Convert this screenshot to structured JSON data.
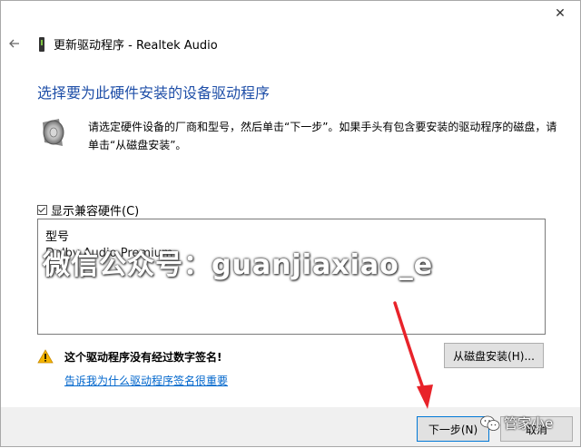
{
  "window": {
    "title": "更新驱动程序 - Realtek Audio",
    "close_symbol": "✕"
  },
  "main": {
    "heading": "选择要为此硬件安装的设备驱动程序",
    "description": "请选定硬件设备的厂商和型号，然后单击“下一步”。如果手头有包含要安装的驱动程序的磁盘，请单击“从磁盘安装”。",
    "compat_checkbox_label": "显示兼容硬件(C)",
    "compat_checked": true,
    "list": {
      "header": "型号",
      "items": [
        "Dolby Audio Premium"
      ]
    },
    "warning_text": "这个驱动程序没有经过数字签名!",
    "link_text": "告诉我为什么驱动程序签名很重要",
    "have_disk_button": "从磁盘安装(H)..."
  },
  "footer": {
    "next_button": "下一步(N)",
    "cancel_button": "取消"
  },
  "overlay": {
    "watermark": "微信公众号：guanjiaxiao_e",
    "wechat_badge": "管家小e"
  },
  "colors": {
    "heading": "#1f4fa8",
    "link": "#0066cc",
    "arrow": "#e8232a",
    "footer": "#f0f0f0"
  },
  "icons": [
    "close-icon",
    "back-arrow-icon",
    "device-icon",
    "speaker-icon",
    "warning-icon",
    "wechat-icon",
    "red-arrow-annotation"
  ]
}
